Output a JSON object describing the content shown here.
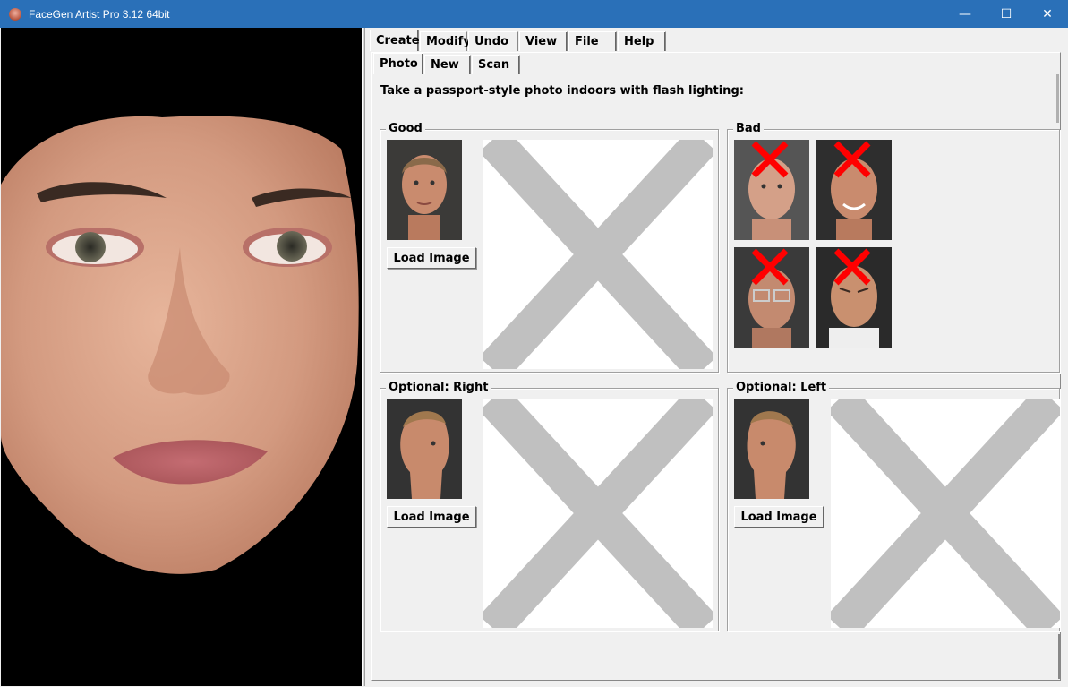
{
  "window": {
    "title": "FaceGen Artist Pro 3.12 64bit",
    "minimize_glyph": "—",
    "maximize_glyph": "☐",
    "close_glyph": "✕"
  },
  "main_tabs": [
    "Create",
    "Modify",
    "Undo",
    "View",
    "File",
    "Help"
  ],
  "sub_tabs": [
    "Photo",
    "New",
    "Scan"
  ],
  "instruction": "Take a passport-style photo indoors with flash lighting:",
  "groups": {
    "good": {
      "title": "Good",
      "load_label": "Load Image"
    },
    "bad": {
      "title": "Bad"
    },
    "right": {
      "title": "Optional: Right",
      "load_label": "Load Image"
    },
    "left": {
      "title": "Optional: Left",
      "load_label": "Load Image"
    }
  },
  "colors": {
    "titlebar": "#2a70b8",
    "placeholder_x": "#c0c0c0",
    "bad_cross": "#ff0000"
  }
}
